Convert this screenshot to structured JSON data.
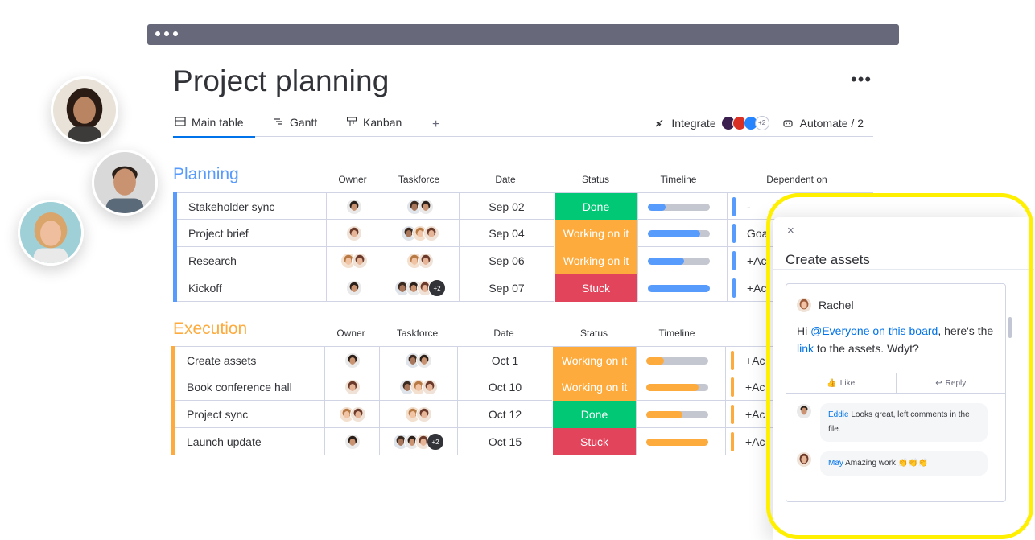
{
  "board": {
    "title": "Project planning",
    "more": "•••",
    "views": [
      {
        "label": "Main table"
      },
      {
        "label": "Gantt"
      },
      {
        "label": "Kanban"
      }
    ],
    "add_view": "+",
    "integrate_label": "Integrate",
    "integrate_more": "+2",
    "automate_label": "Automate / 2"
  },
  "columns": {
    "owner": "Owner",
    "taskforce": "Taskforce",
    "date": "Date",
    "status": "Status",
    "timeline": "Timeline",
    "dependent": "Dependent on"
  },
  "colors": {
    "planning": "#579bfc",
    "execution": "#fdab3d",
    "done": "#00c875",
    "working": "#fdab3d",
    "stuck": "#e2445c"
  },
  "groups": {
    "planning": {
      "title": "Planning",
      "rows": [
        {
          "name": "Stakeholder sync",
          "date": "Sep 02",
          "status": "Done",
          "dep": "-"
        },
        {
          "name": "Project brief",
          "date": "Sep 04",
          "status": "Working on it",
          "dep": "Goa"
        },
        {
          "name": "Research",
          "date": "Sep 06",
          "status": "Working on it",
          "dep": "+Ac"
        },
        {
          "name": "Kickoff",
          "date": "Sep 07",
          "status": "Stuck",
          "dep": "+Ac"
        }
      ]
    },
    "execution": {
      "title": "Execution",
      "rows": [
        {
          "name": "Create assets",
          "date": "Oct 1",
          "status": "Working on it",
          "dep": "+Ac"
        },
        {
          "name": "Book conference hall",
          "date": "Oct 10",
          "status": "Working on it",
          "dep": "+Ac"
        },
        {
          "name": "Project sync",
          "date": "Oct 12",
          "status": "Done",
          "dep": "+Ac"
        },
        {
          "name": "Launch update",
          "date": "Oct 15",
          "status": "Stuck",
          "dep": "+Ac"
        }
      ]
    }
  },
  "timeline_progress": {
    "planning": [
      0.28,
      0.85,
      0.58,
      1.0
    ],
    "execution": [
      0.28,
      0.85,
      0.58,
      1.0
    ]
  },
  "taskforce_extra": "+2",
  "panel": {
    "close": "×",
    "title": "Create assets",
    "author": "Rachel",
    "msg_prefix": "Hi ",
    "msg_mention": "@Everyone on this board",
    "msg_middle": ", here's the ",
    "msg_link": "link",
    "msg_suffix": " to the assets. Wdyt?",
    "like": "Like",
    "reply": "Reply",
    "replies": [
      {
        "name": "Eddie",
        "text": " Looks great, left comments in the file."
      },
      {
        "name": "May",
        "text": " Amazing work 👏👏👏"
      }
    ]
  }
}
